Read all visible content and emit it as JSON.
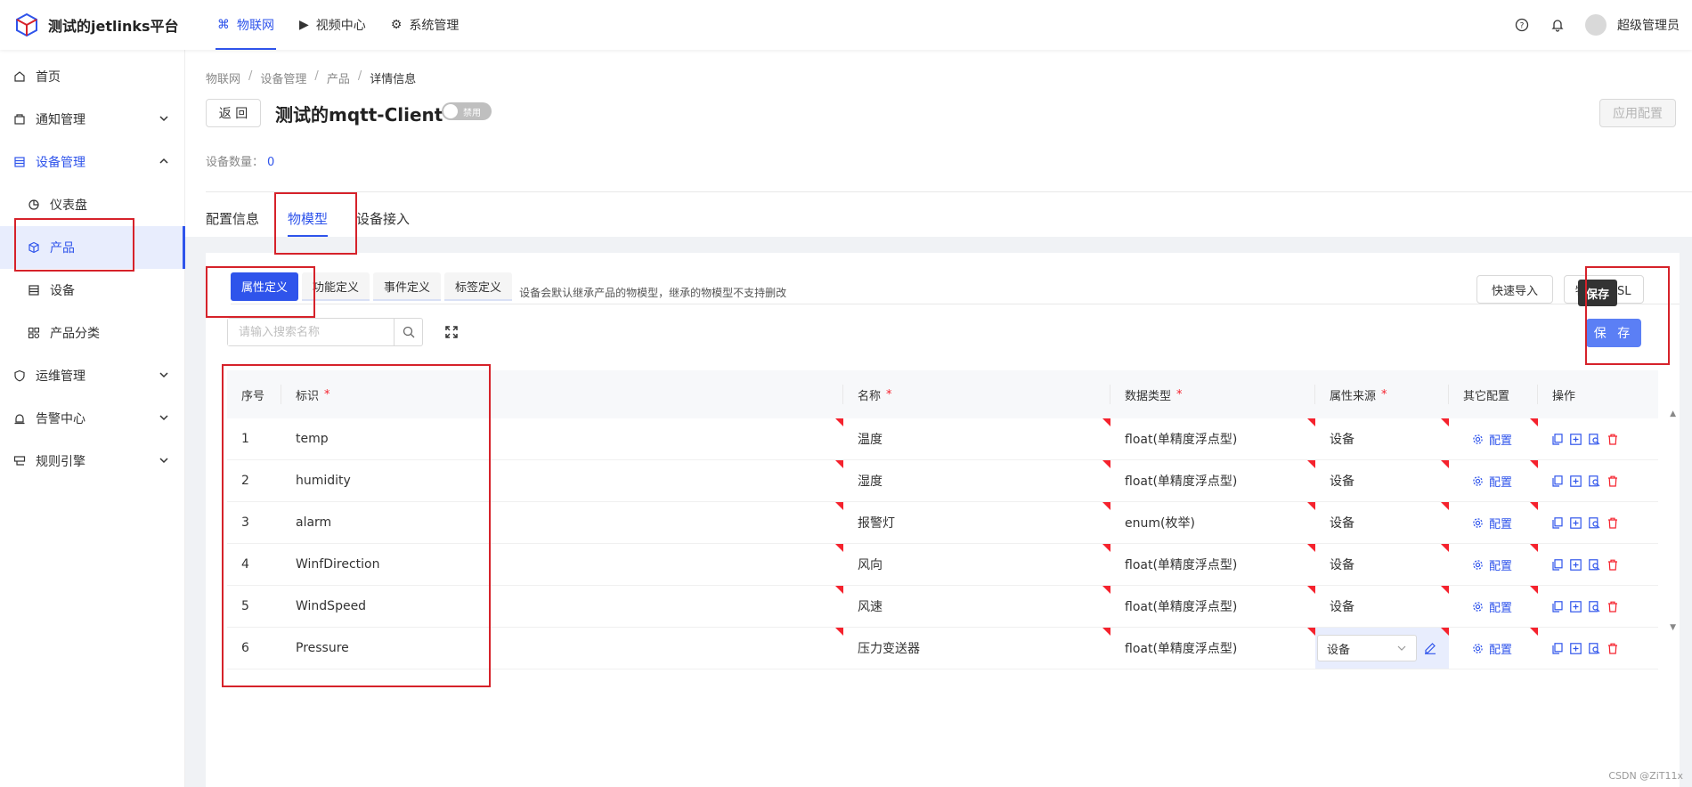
{
  "app": {
    "title": "测试的jetlinks平台"
  },
  "topnav": [
    {
      "label": "物联网",
      "icon": "iot-icon",
      "active": true
    },
    {
      "label": "视频中心",
      "icon": "video-icon",
      "active": false
    },
    {
      "label": "系统管理",
      "icon": "system-icon",
      "active": false
    }
  ],
  "header": {
    "username": "超级管理员"
  },
  "sidebar": {
    "items": [
      {
        "label": "首页"
      },
      {
        "label": "通知管理"
      },
      {
        "label": "设备管理"
      },
      {
        "label": "仪表盘"
      },
      {
        "label": "产品"
      },
      {
        "label": "设备"
      },
      {
        "label": "产品分类"
      },
      {
        "label": "运维管理"
      },
      {
        "label": "告警中心"
      },
      {
        "label": "规则引擎"
      }
    ]
  },
  "breadcrumb": [
    "物联网",
    "设备管理",
    "产品",
    "详情信息"
  ],
  "page": {
    "back_label": "返 回",
    "title": "测试的mqtt-Client",
    "toggle_label": "禁用",
    "apply_label": "应用配置",
    "device_count_label": "设备数量：",
    "device_count": "0"
  },
  "tabs": [
    "配置信息",
    "物模型",
    "设备接入"
  ],
  "subtabs": [
    "属性定义",
    "功能定义",
    "事件定义",
    "标签定义"
  ],
  "subtab_hint": "设备会默认继承产品的物模型，继承的物模型不支持删改",
  "toolbar": {
    "quick_import": "快速导入",
    "tsl_button": "物模型TSL",
    "tooltip": "保存",
    "save": "保 存"
  },
  "search": {
    "placeholder": "请输入搜索名称",
    "value": ""
  },
  "table": {
    "headers": {
      "index": "序号",
      "identifier": "标识",
      "name": "名称",
      "data_type": "数据类型",
      "source": "属性来源",
      "other": "其它配置",
      "ops": "操作",
      "required_mark": "*"
    },
    "config_label": "配置",
    "rows": [
      {
        "index": "1",
        "identifier": "temp",
        "name": "温度",
        "data_type": "float(单精度浮点型)",
        "source": "设备"
      },
      {
        "index": "2",
        "identifier": "humidity",
        "name": "湿度",
        "data_type": "float(单精度浮点型)",
        "source": "设备"
      },
      {
        "index": "3",
        "identifier": "alarm",
        "name": "报警灯",
        "data_type": "enum(枚举)",
        "source": "设备"
      },
      {
        "index": "4",
        "identifier": "WinfDirection",
        "name": "风向",
        "data_type": "float(单精度浮点型)",
        "source": "设备"
      },
      {
        "index": "5",
        "identifier": "WindSpeed",
        "name": "风速",
        "data_type": "float(单精度浮点型)",
        "source": "设备"
      },
      {
        "index": "6",
        "identifier": "Pressure",
        "name": "压力变送器",
        "data_type": "float(单精度浮点型)",
        "source": "设备"
      }
    ]
  },
  "watermark": "CSDN @ZiT11x",
  "colors": {
    "accent": "#2f54eb",
    "annotation": "#d6222a",
    "required": "#f5222d"
  }
}
